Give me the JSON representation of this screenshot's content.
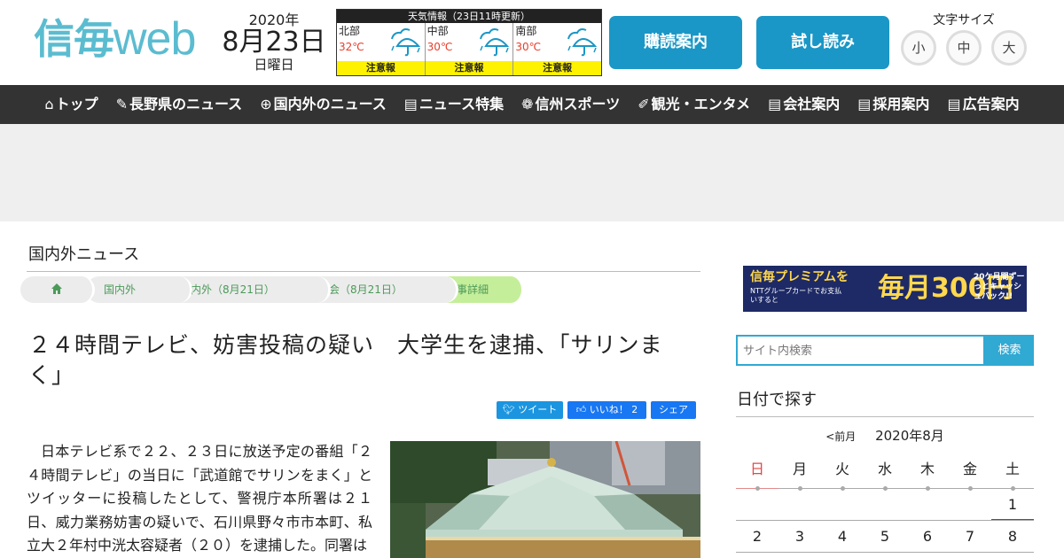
{
  "header": {
    "logo_kanji": "信毎",
    "logo_web": "web",
    "date": {
      "year": "2020年",
      "month_day": "8月23日",
      "weekday": "日曜日"
    },
    "weather": {
      "title": "天気情報（23日11時更新）",
      "regions": [
        {
          "name": "北部",
          "temp": "32℃",
          "warning": "注意報",
          "icon": "rain-umbrella-icon"
        },
        {
          "name": "中部",
          "temp": "30℃",
          "warning": "注意報",
          "icon": "rain-umbrella-icon"
        },
        {
          "name": "南部",
          "temp": "30℃",
          "warning": "注意報",
          "icon": "rain-umbrella-icon"
        }
      ]
    },
    "subscribe_label": "購読案内",
    "trial_label": "試し読み",
    "font_size": {
      "label": "文字サイズ",
      "small": "小",
      "medium": "中",
      "large": "大"
    }
  },
  "nav": [
    {
      "icon": "⌂",
      "label": "トップ"
    },
    {
      "icon": "✎",
      "label": "長野県のニュース"
    },
    {
      "icon": "⊕",
      "label": "国内外のニュース"
    },
    {
      "icon": "▤",
      "label": "ニュース特集"
    },
    {
      "icon": "❁",
      "label": "信州スポーツ"
    },
    {
      "icon": "✐",
      "label": "観光・エンタメ"
    },
    {
      "icon": "▤",
      "label": "会社案内"
    },
    {
      "icon": "▤",
      "label": "採用案内"
    },
    {
      "icon": "▤",
      "label": "広告案内"
    }
  ],
  "main": {
    "section_title": "国内外ニュース",
    "breadcrumbs": [
      "国内外",
      "国内外（8月21日）",
      "社会（8月21日）",
      "記事詳細"
    ],
    "headline": "２４時間テレビ、妨害投稿の疑い　大学生を逮捕、「サリンまく」",
    "social": {
      "tweet": "ツイート",
      "like": "いいね！ 2",
      "share": "シェア"
    },
    "body": "日本テレビ系で２２、２３日に放送予定の番組「２４時間テレビ」の当日に「武道館でサリンをまく」とツイッターに投稿したとして、警視庁本所署は２１日、威力業務妨害の疑いで、石川県野々市市本町、私立大２年村中洸太容疑者（２０）を逮捕した。同署は"
  },
  "sidebar": {
    "banner": {
      "brand": "信毎プレミアムを",
      "sub": "NTTグループカードでお支払いすると",
      "main": "毎月300円",
      "right": "20ケ月間ずーっとキャッシュバック!!"
    },
    "search": {
      "placeholder": "サイト内検索",
      "button": "検索"
    },
    "date_title": "日付で探す",
    "calendar": {
      "prev": "<前月",
      "month": "2020年8月",
      "weekdays": [
        "日",
        "月",
        "火",
        "水",
        "木",
        "金",
        "土"
      ],
      "weeks": [
        [
          "",
          "",
          "",
          "",
          "",
          "",
          "1"
        ],
        [
          "2",
          "3",
          "4",
          "5",
          "6",
          "7",
          "8"
        ]
      ]
    }
  },
  "colors": {
    "accent": "#1a97c6",
    "nav_bg": "#333333",
    "logo": "#5bbcd0",
    "crumb_current": "#c5ee9a"
  }
}
